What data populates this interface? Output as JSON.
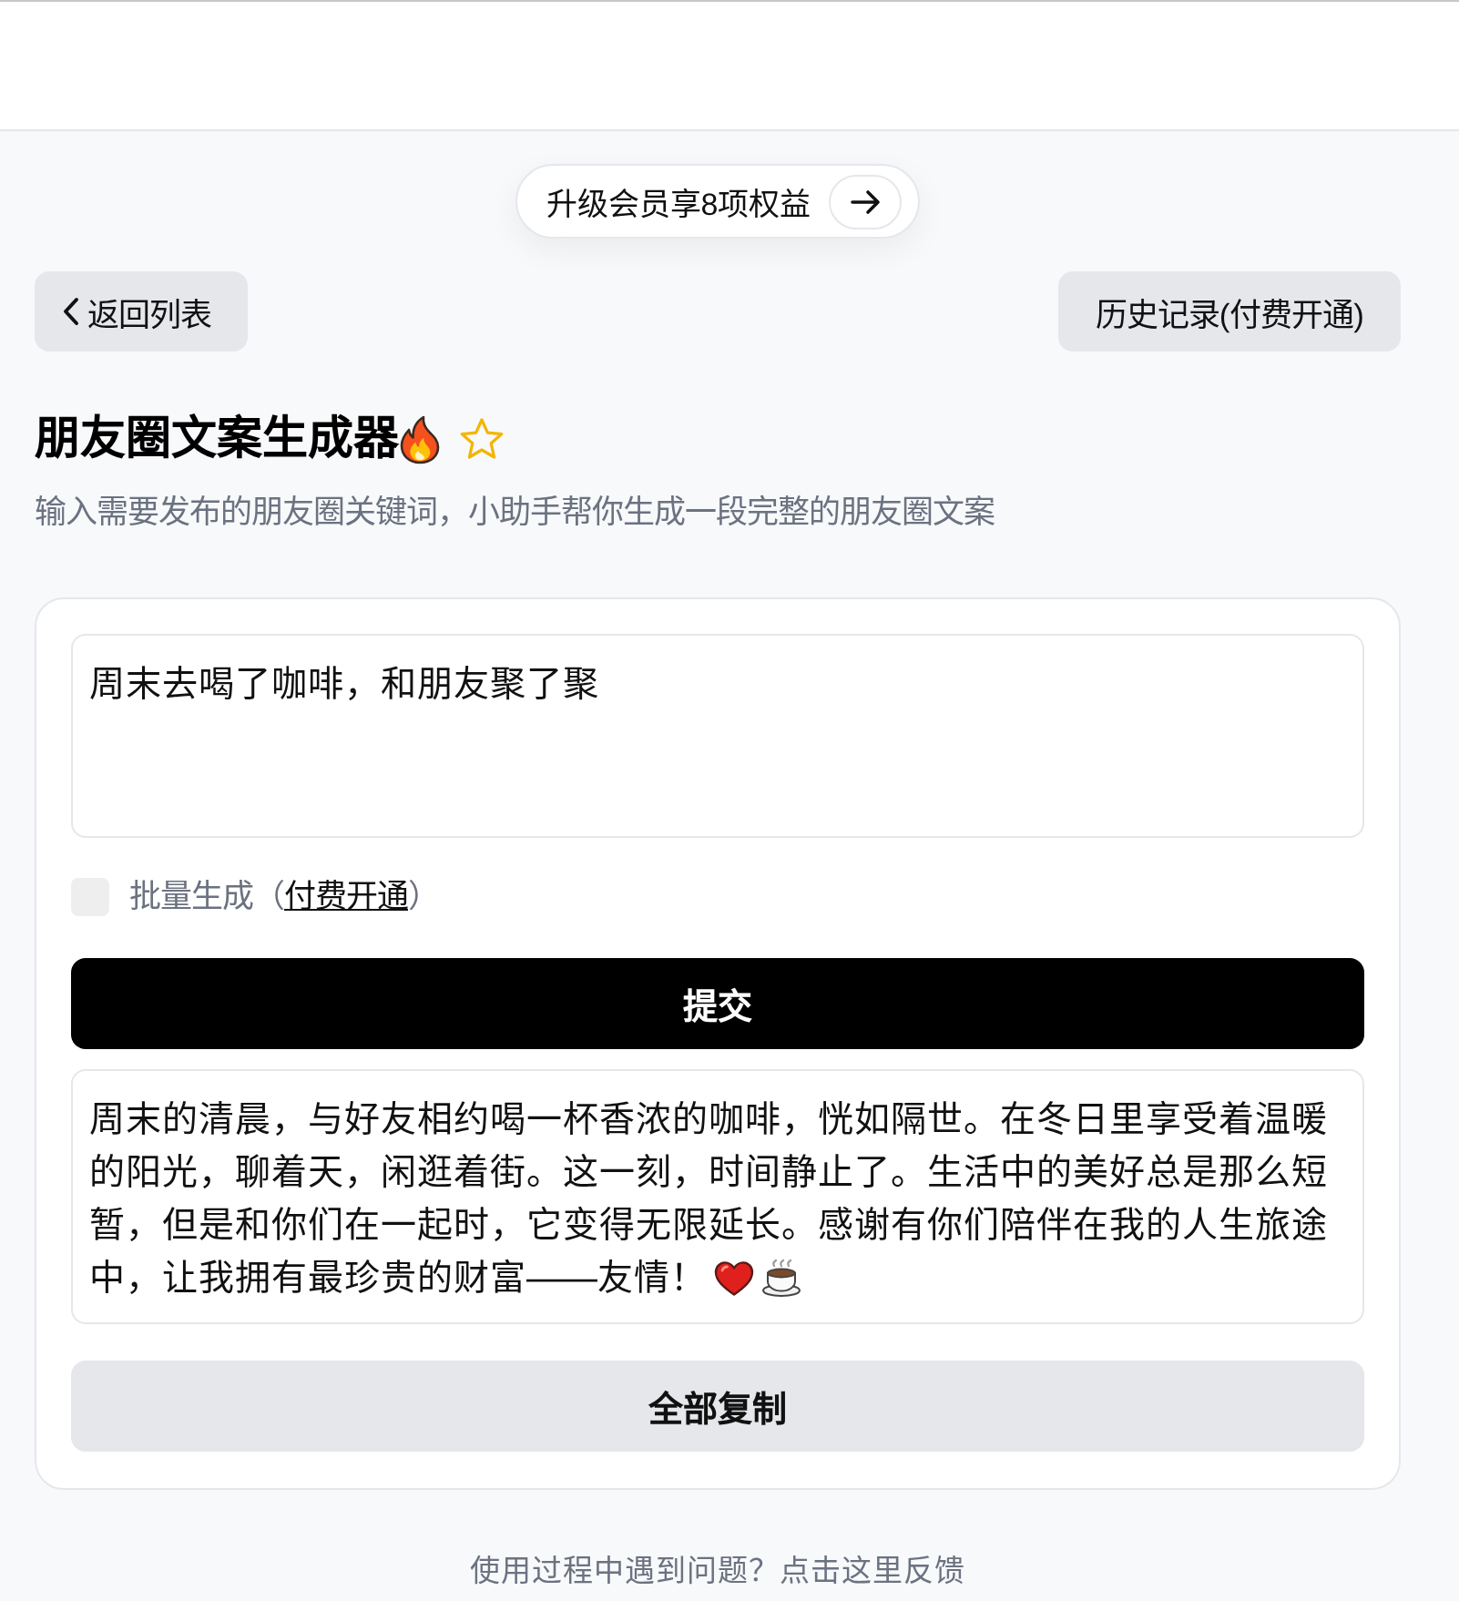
{
  "upgrade_banner": {
    "label": "升级会员享8项权益"
  },
  "nav": {
    "back_button": "返回列表",
    "history_button": "历史记录(付费开通)"
  },
  "tool": {
    "title": "朋友圈文案生成器",
    "favorited": false,
    "description": "输入需要发布的朋友圈关键词，小助手帮你生成一段完整的朋友圈文案"
  },
  "form": {
    "input": {
      "value": "周末去喝了咖啡，和朋友聚了聚"
    },
    "batch_option": {
      "checked": false,
      "before": "批量生成（",
      "link": "付费开通",
      "after": "）"
    },
    "submit_button": "提交"
  },
  "result": {
    "text": "周末的清晨，与好友相约喝一杯香浓的咖啡，恍如隔世。在冬日里享受着温暖的阳光，聊着天，闲逛着街。这一刻，时间静止了。生活中的美好总是那么短暂，但是和你们在一起时，它变得无限延长。感谢有你们陪伴在我的人生旅途中，让我拥有最珍贵的财富——友情！",
    "copy_button": "全部复制"
  },
  "footer": {
    "feedback": "使用过程中遇到问题？点击这里反馈"
  }
}
